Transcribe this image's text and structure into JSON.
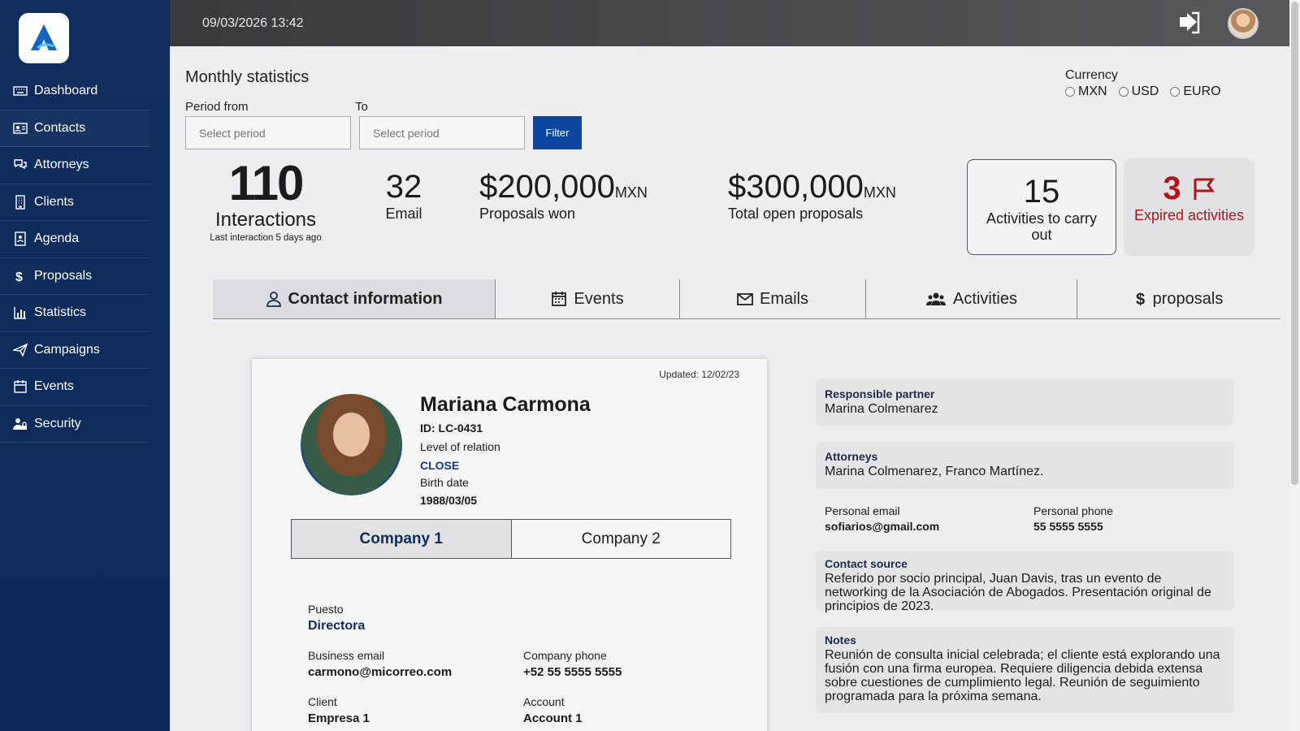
{
  "topbar": {
    "datetime": "09/03/2026 13:42"
  },
  "sidebar": {
    "items": [
      {
        "label": "Dashboard",
        "icon": "keyboard-icon"
      },
      {
        "label": "Contacts",
        "icon": "contact-card-icon"
      },
      {
        "label": "Attorneys",
        "icon": "chat-bubbles-icon"
      },
      {
        "label": "Clients",
        "icon": "building-icon"
      },
      {
        "label": "Agenda",
        "icon": "address-book-icon"
      },
      {
        "label": "Proposals",
        "icon": "dollar-icon"
      },
      {
        "label": "Statistics",
        "icon": "bar-chart-icon"
      },
      {
        "label": "Campaigns",
        "icon": "paper-plane-icon"
      },
      {
        "label": "Events",
        "icon": "calendar-icon"
      },
      {
        "label": "Security",
        "icon": "user-lock-icon"
      }
    ]
  },
  "filters": {
    "title": "Monthly statistics",
    "from_label": "Period from",
    "to_label": "To",
    "from_placeholder": "Select period",
    "to_placeholder": "Select period",
    "filter_label": "Filter"
  },
  "currency": {
    "label": "Currency",
    "options": [
      "MXN",
      "USD",
      "EURO"
    ]
  },
  "stats": {
    "interactions_value": "110",
    "interactions_label": "Interactions",
    "interactions_sub": "Last interaction 5 days ago",
    "email_value": "32",
    "email_label": "Email",
    "won_value": "$200,000",
    "won_unit": "MXN",
    "won_label": "Proposals won",
    "open_value": "$300,000",
    "open_unit": "MXN",
    "open_label": "Total open proposals",
    "activities_value": "15",
    "activities_label": "Activities to carry out",
    "expired_value": "3",
    "expired_label": "Expired activities"
  },
  "tabs": [
    {
      "label": "Contact information"
    },
    {
      "label": "Events"
    },
    {
      "label": "Emails"
    },
    {
      "label": "Activities"
    },
    {
      "label": "proposals"
    }
  ],
  "contact": {
    "updated": "Updated: 12/02/23",
    "name": "Mariana Carmona",
    "id": "ID: LC-0431",
    "relation_label": "Level of relation",
    "relation_value": "CLOSE",
    "birth_label": "Birth date",
    "birth_value": "1988/03/05",
    "company_tabs": [
      "Company 1",
      "Company 2"
    ],
    "position_label": "Puesto",
    "position_value": "Directora",
    "business_email_label": "Business email",
    "business_email_value": "carmono@micorreo.com",
    "company_phone_label": "Company phone",
    "company_phone_value": "+52 55 5555 5555",
    "client_label": "Client",
    "client_value": "Empresa 1",
    "account_label": "Account",
    "account_value": "Account 1"
  },
  "details": {
    "partner_label": "Responsible partner",
    "partner_value": "Marina Colmenarez",
    "attorneys_label": "Attorneys",
    "attorneys_value": "Marina Colmenarez, Franco Martínez.",
    "personal_email_label": "Personal email",
    "personal_email_value": "sofiarios@gmail.com",
    "personal_phone_label": "Personal phone",
    "personal_phone_value": "55 5555 5555",
    "source_label": "Contact source",
    "source_value": "Referido por socio principal, Juan Davis, tras un evento de networking de la Asociación de Abogados. Presentación original de principios de 2023.",
    "notes_label": "Notes",
    "notes_value": "Reunión de consulta inicial celebrada; el cliente está explorando una fusión con una firma europea. Requiere diligencia debida extensa sobre cuestiones de cumplimiento legal. Reunión de seguimiento programada para la próxima semana."
  },
  "colors": {
    "sidebar": "#0f2d5e",
    "accent": "#0d47a1",
    "danger": "#b3141b"
  }
}
